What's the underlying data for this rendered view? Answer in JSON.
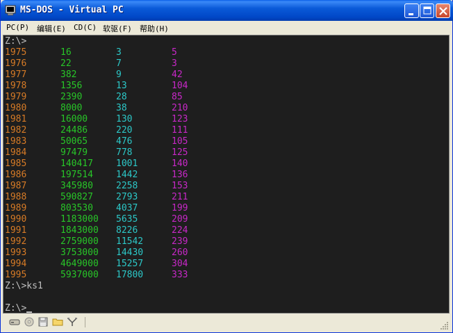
{
  "window": {
    "title": "MS-DOS - Virtual PC"
  },
  "menu": [
    {
      "label": "PC(P)"
    },
    {
      "label": "编辑(E)"
    },
    {
      "label": "CD(C)"
    },
    {
      "label": "软驱(F)"
    },
    {
      "label": "帮助(H)"
    }
  ],
  "console": {
    "prompt_top": "Z:\\>",
    "command_line": "Z:\\>ks1",
    "prompt_bottom": "Z:\\>",
    "rows": [
      {
        "year": "1975",
        "a": "16",
        "b": "3",
        "c": "5"
      },
      {
        "year": "1976",
        "a": "22",
        "b": "7",
        "c": "3"
      },
      {
        "year": "1977",
        "a": "382",
        "b": "9",
        "c": "42"
      },
      {
        "year": "1978",
        "a": "1356",
        "b": "13",
        "c": "104"
      },
      {
        "year": "1979",
        "a": "2390",
        "b": "28",
        "c": "85"
      },
      {
        "year": "1980",
        "a": "8000",
        "b": "38",
        "c": "210"
      },
      {
        "year": "1981",
        "a": "16000",
        "b": "130",
        "c": "123"
      },
      {
        "year": "1982",
        "a": "24486",
        "b": "220",
        "c": "111"
      },
      {
        "year": "1983",
        "a": "50065",
        "b": "476",
        "c": "105"
      },
      {
        "year": "1984",
        "a": "97479",
        "b": "778",
        "c": "125"
      },
      {
        "year": "1985",
        "a": "140417",
        "b": "1001",
        "c": "140"
      },
      {
        "year": "1986",
        "a": "197514",
        "b": "1442",
        "c": "136"
      },
      {
        "year": "1987",
        "a": "345980",
        "b": "2258",
        "c": "153"
      },
      {
        "year": "1988",
        "a": "590827",
        "b": "2793",
        "c": "211"
      },
      {
        "year": "1989",
        "a": "803530",
        "b": "4037",
        "c": "199"
      },
      {
        "year": "1990",
        "a": "1183000",
        "b": "5635",
        "c": "209"
      },
      {
        "year": "1991",
        "a": "1843000",
        "b": "8226",
        "c": "224"
      },
      {
        "year": "1992",
        "a": "2759000",
        "b": "11542",
        "c": "239"
      },
      {
        "year": "1993",
        "a": "3753000",
        "b": "14430",
        "c": "260"
      },
      {
        "year": "1994",
        "a": "4649000",
        "b": "15257",
        "c": "304"
      },
      {
        "year": "1995",
        "a": "5937000",
        "b": "17800",
        "c": "333"
      }
    ],
    "colors": {
      "year": "#d77b26",
      "a": "#28c628",
      "b": "#2cc8c8",
      "c": "#c828c8",
      "background": "#1e1e1e"
    }
  },
  "statusbar": {
    "icons": [
      "hard-disk-icon",
      "cd-icon",
      "floppy-icon",
      "shared-folder-icon",
      "network-icon"
    ]
  }
}
